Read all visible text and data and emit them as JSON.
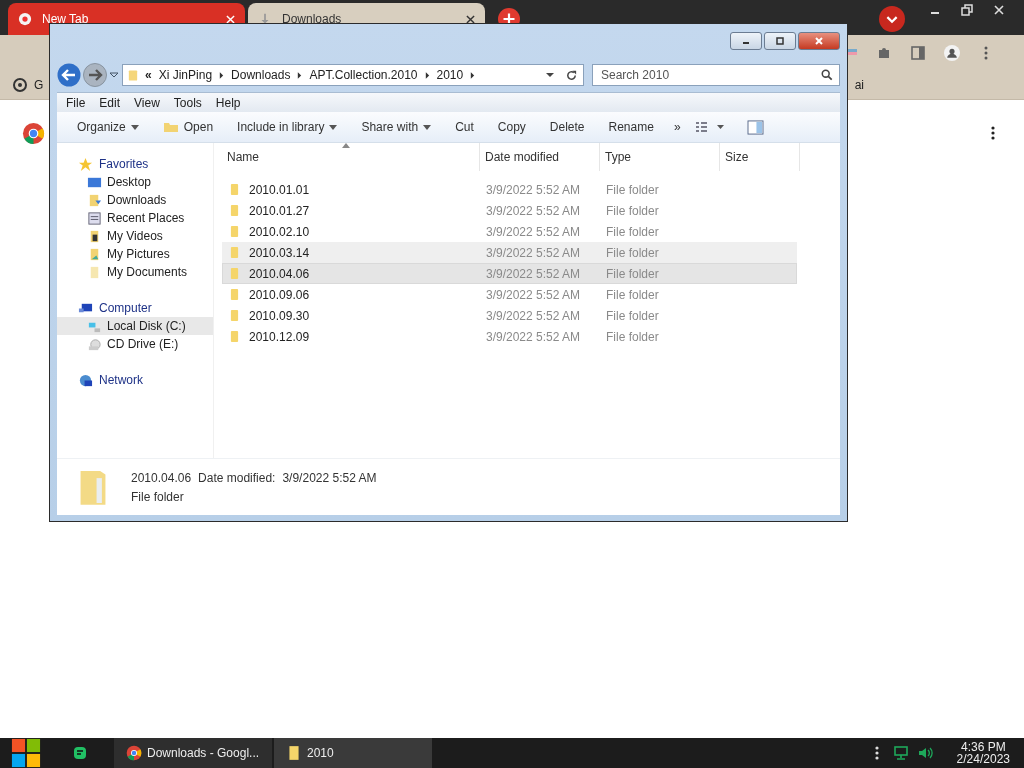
{
  "browser": {
    "tabs": [
      {
        "title": "New Tab",
        "selected": false
      },
      {
        "title": "Downloads",
        "selected": true
      }
    ],
    "bookmarks": [
      "G",
      "ai"
    ]
  },
  "explorer": {
    "breadcrumb_prefix": "«",
    "breadcrumb": [
      "Xi JinPing",
      "Downloads",
      "APT.Collection.2010",
      "2010"
    ],
    "search": {
      "placeholder": "Search 2010"
    },
    "menu": [
      "File",
      "Edit",
      "View",
      "Tools",
      "Help"
    ],
    "commands": [
      {
        "label": "Organize",
        "kind": "dropdown"
      },
      {
        "label": "Open",
        "kind": "folder"
      },
      {
        "label": "Include in library",
        "kind": "dropdown"
      },
      {
        "label": "Share with",
        "kind": "dropdown"
      },
      {
        "label": "Cut",
        "kind": "plain"
      },
      {
        "label": "Copy",
        "kind": "plain"
      },
      {
        "label": "Delete",
        "kind": "plain"
      },
      {
        "label": "Rename",
        "kind": "plain"
      }
    ],
    "more": "»",
    "nav": [
      {
        "label": "Favorites",
        "kind": "star",
        "children": [
          {
            "label": "Desktop",
            "kind": "desktop",
            "selected": false
          },
          {
            "label": "Downloads",
            "kind": "downloads",
            "selected": false
          },
          {
            "label": "Recent Places",
            "kind": "recent",
            "selected": false
          },
          {
            "label": "My Videos",
            "kind": "videos",
            "selected": false
          },
          {
            "label": "My Pictures",
            "kind": "pictures",
            "selected": false
          },
          {
            "label": "My Documents",
            "kind": "documents",
            "selected": false
          }
        ]
      },
      {
        "label": "Computer",
        "kind": "computer",
        "children": [
          {
            "label": "Local Disk (C:)",
            "kind": "drive",
            "selected": true
          },
          {
            "label": "CD Drive (E:)",
            "kind": "cd",
            "selected": false
          }
        ]
      },
      {
        "label": "Network",
        "kind": "network"
      }
    ],
    "columns": [
      "Name",
      "Date modified",
      "Type",
      "Size"
    ],
    "rows": [
      {
        "name": "2010.01.01",
        "date": "3/9/2022 5:52 AM",
        "type": "File folder",
        "selected": false,
        "hovered": false
      },
      {
        "name": "2010.01.27",
        "date": "3/9/2022 5:52 AM",
        "type": "File folder",
        "selected": false,
        "hovered": false
      },
      {
        "name": "2010.02.10",
        "date": "3/9/2022 5:52 AM",
        "type": "File folder",
        "selected": false,
        "hovered": false
      },
      {
        "name": "2010.03.14",
        "date": "3/9/2022 5:52 AM",
        "type": "File folder",
        "selected": false,
        "hovered": true
      },
      {
        "name": "2010.04.06",
        "date": "3/9/2022 5:52 AM",
        "type": "File folder",
        "selected": true,
        "hovered": false
      },
      {
        "name": "2010.09.06",
        "date": "3/9/2022 5:52 AM",
        "type": "File folder",
        "selected": false,
        "hovered": false
      },
      {
        "name": "2010.09.30",
        "date": "3/9/2022 5:52 AM",
        "type": "File folder",
        "selected": false,
        "hovered": false
      },
      {
        "name": "2010.12.09",
        "date": "3/9/2022 5:52 AM",
        "type": "File folder",
        "selected": false,
        "hovered": false
      }
    ],
    "details": {
      "name": "2010.04.06",
      "date_label": "Date modified:",
      "date": "3/9/2022 5:52 AM",
      "type": "File folder"
    }
  },
  "taskbar": {
    "tasks": [
      {
        "label": "Downloads - Googl...",
        "kind": "chrome",
        "selected": false
      },
      {
        "label": "2010",
        "kind": "folder",
        "selected": true
      }
    ],
    "time": "4:36 PM",
    "date": "2/24/2023"
  }
}
